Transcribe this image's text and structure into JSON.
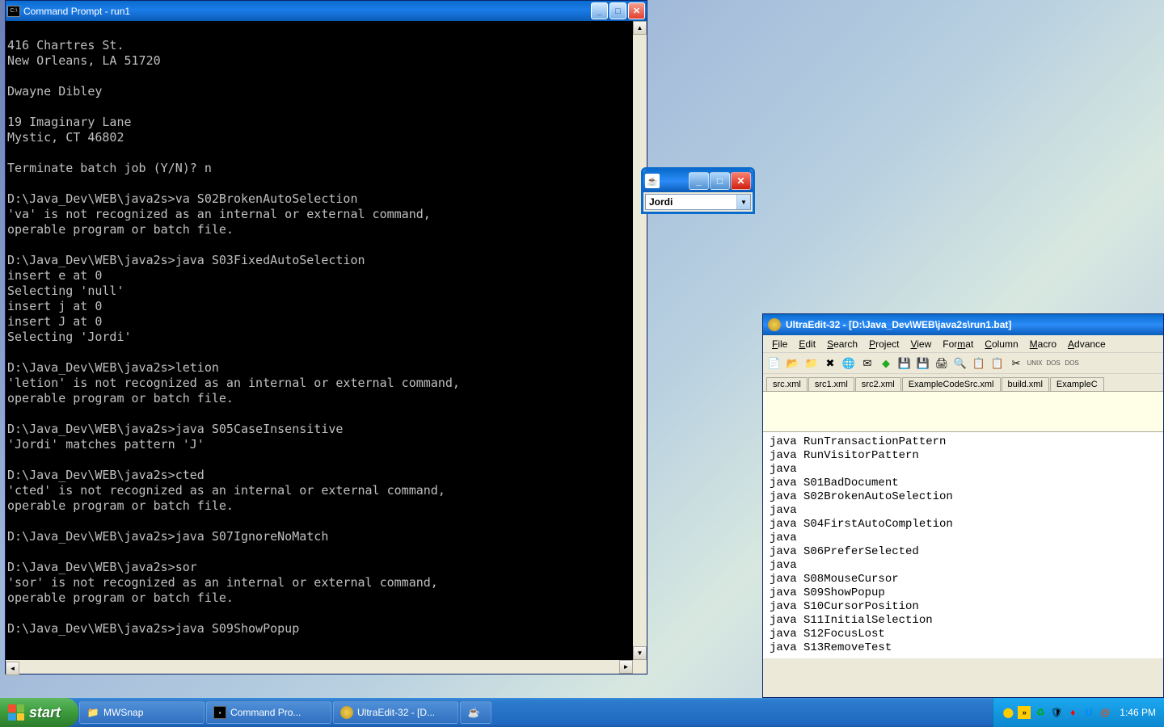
{
  "cmd": {
    "title": "Command Prompt - run1",
    "output": "\n416 Chartres St.\nNew Orleans, LA 51720\n\nDwayne Dibley\n\n19 Imaginary Lane\nMystic, CT 46802\n\nTerminate batch job (Y/N)? n\n\nD:\\Java_Dev\\WEB\\java2s>va S02BrokenAutoSelection\n'va' is not recognized as an internal or external command,\noperable program or batch file.\n\nD:\\Java_Dev\\WEB\\java2s>java S03FixedAutoSelection\ninsert e at 0\nSelecting 'null'\ninsert j at 0\ninsert J at 0\nSelecting 'Jordi'\n\nD:\\Java_Dev\\WEB\\java2s>letion\n'letion' is not recognized as an internal or external command,\noperable program or batch file.\n\nD:\\Java_Dev\\WEB\\java2s>java S05CaseInsensitive\n'Jordi' matches pattern 'J'\n\nD:\\Java_Dev\\WEB\\java2s>cted\n'cted' is not recognized as an internal or external command,\noperable program or batch file.\n\nD:\\Java_Dev\\WEB\\java2s>java S07IgnoreNoMatch\n\nD:\\Java_Dev\\WEB\\java2s>sor\n'sor' is not recognized as an internal or external command,\noperable program or batch file.\n\nD:\\Java_Dev\\WEB\\java2s>java S09ShowPopup"
  },
  "java_popup": {
    "combo_value": "Jordi"
  },
  "ultraedit": {
    "title": "UltraEdit-32 - [D:\\Java_Dev\\WEB\\java2s\\run1.bat]",
    "menus": [
      "File",
      "Edit",
      "Search",
      "Project",
      "View",
      "Format",
      "Column",
      "Macro",
      "Advance"
    ],
    "tabs": [
      "src.xml",
      "src1.xml",
      "src2.xml",
      "ExampleCodeSrc.xml",
      "build.xml",
      "ExampleC"
    ],
    "content": "java RunTransactionPattern\njava RunVisitorPattern\njava\njava S01BadDocument\njava S02BrokenAutoSelection\njava\njava S04FirstAutoCompletion\njava\njava S06PreferSelected\njava\njava S08MouseCursor\njava S09ShowPopup\njava S10CursorPosition\njava S11InitialSelection\njava S12FocusLost\njava S13RemoveTest"
  },
  "taskbar": {
    "start": "start",
    "items": [
      {
        "label": "MWSnap",
        "icon": "📁"
      },
      {
        "label": "Command Pro...",
        "icon": "▪"
      },
      {
        "label": "UltraEdit-32 - [D...",
        "icon": "●"
      },
      {
        "label": "",
        "icon": "☕"
      }
    ],
    "clock": "1:46 PM"
  }
}
